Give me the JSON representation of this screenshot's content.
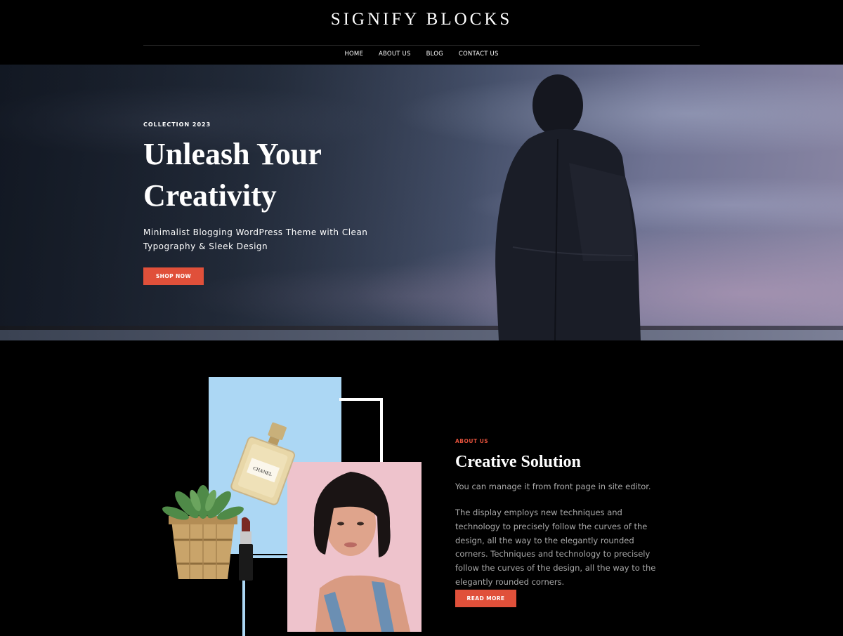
{
  "site": {
    "title": "SIGNIFY BLOCKS"
  },
  "nav": {
    "items": [
      {
        "label": "HOME"
      },
      {
        "label": "ABOUT US"
      },
      {
        "label": "BLOG"
      },
      {
        "label": "CONTACT US"
      }
    ]
  },
  "hero": {
    "eyebrow": "COLLECTION 2023",
    "heading": "Unleash Your Creativity",
    "subtitle": "Minimalist Blogging WordPress Theme with Clean Typography & Sleek Design",
    "button_label": "SHOP NOW"
  },
  "about": {
    "eyebrow": "ABOUT US",
    "title": "Creative Solution",
    "intro": "You can manage it from front page in site editor.",
    "body": "The display employs new techniques and technology to precisely follow the curves of the design, all the way to the elegantly rounded corners. Techniques and technology to precisely follow the curves of the design, all the way to the elegantly rounded corners.",
    "button_label": "READ MORE"
  },
  "perfume_label": "CHANEL",
  "colors": {
    "accent": "#e0503a",
    "background": "#000000",
    "collage_blue": "#acd7f4",
    "collage_pink": "#eec3cc"
  },
  "icons": {
    "hero_image": "man-silhouette-at-lake",
    "perfume": "perfume-bottle-image",
    "plant": "potted-succulent-image",
    "lipstick": "lipstick-image",
    "portrait": "woman-portrait-image"
  }
}
